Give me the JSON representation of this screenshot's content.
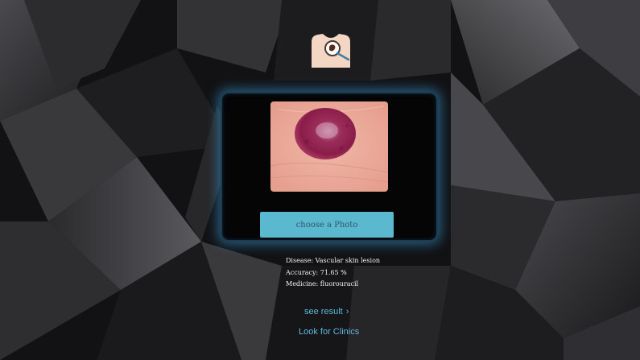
{
  "upload": {
    "button_label": "choose a Photo"
  },
  "results": {
    "disease_label": "Disease:",
    "disease_value": "Vascular skin lesion",
    "accuracy_label": "Accuracy:",
    "accuracy_value": "71.65 %",
    "medicine_label": "Medicine:",
    "medicine_value": "fluorouracil"
  },
  "links": {
    "see_result": "see result",
    "see_result_chevron": "›",
    "look_for_clinics": "Look for Clinics"
  },
  "colors": {
    "accent_button": "#5ab8cf",
    "link": "#5fb8e0",
    "panel_glow": "#3796d2",
    "background": "#0e0e10"
  },
  "icons": {
    "logo": "body-magnifier-icon",
    "chevron": "chevron-right-icon"
  }
}
